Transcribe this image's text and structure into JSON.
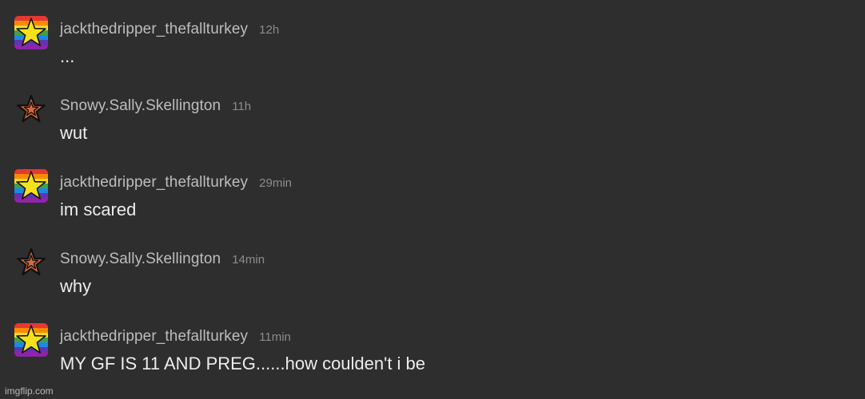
{
  "comments": [
    {
      "username": "jackthedripper_thefallturkey",
      "time": "12h",
      "text": "...",
      "avatar_icon": "rainbow-star-avatar"
    },
    {
      "username": "Snowy.Sally.Skellington",
      "time": "11h",
      "text": "wut",
      "avatar_icon": "orange-outline-star-avatar"
    },
    {
      "username": "jackthedripper_thefallturkey",
      "time": "29min",
      "text": "im scared",
      "avatar_icon": "rainbow-star-avatar"
    },
    {
      "username": "Snowy.Sally.Skellington",
      "time": "14min",
      "text": "why",
      "avatar_icon": "orange-outline-star-avatar"
    },
    {
      "username": "jackthedripper_thefallturkey",
      "time": "11min",
      "text": "MY GF IS 11 AND PREG......how coulden't i be",
      "avatar_icon": "rainbow-star-avatar"
    }
  ],
  "watermark": "imgflip.com",
  "colors": {
    "background": "#2e2e2e",
    "username": "#bdbdbd",
    "timestamp": "#8c8c8c",
    "text": "#ececec"
  }
}
